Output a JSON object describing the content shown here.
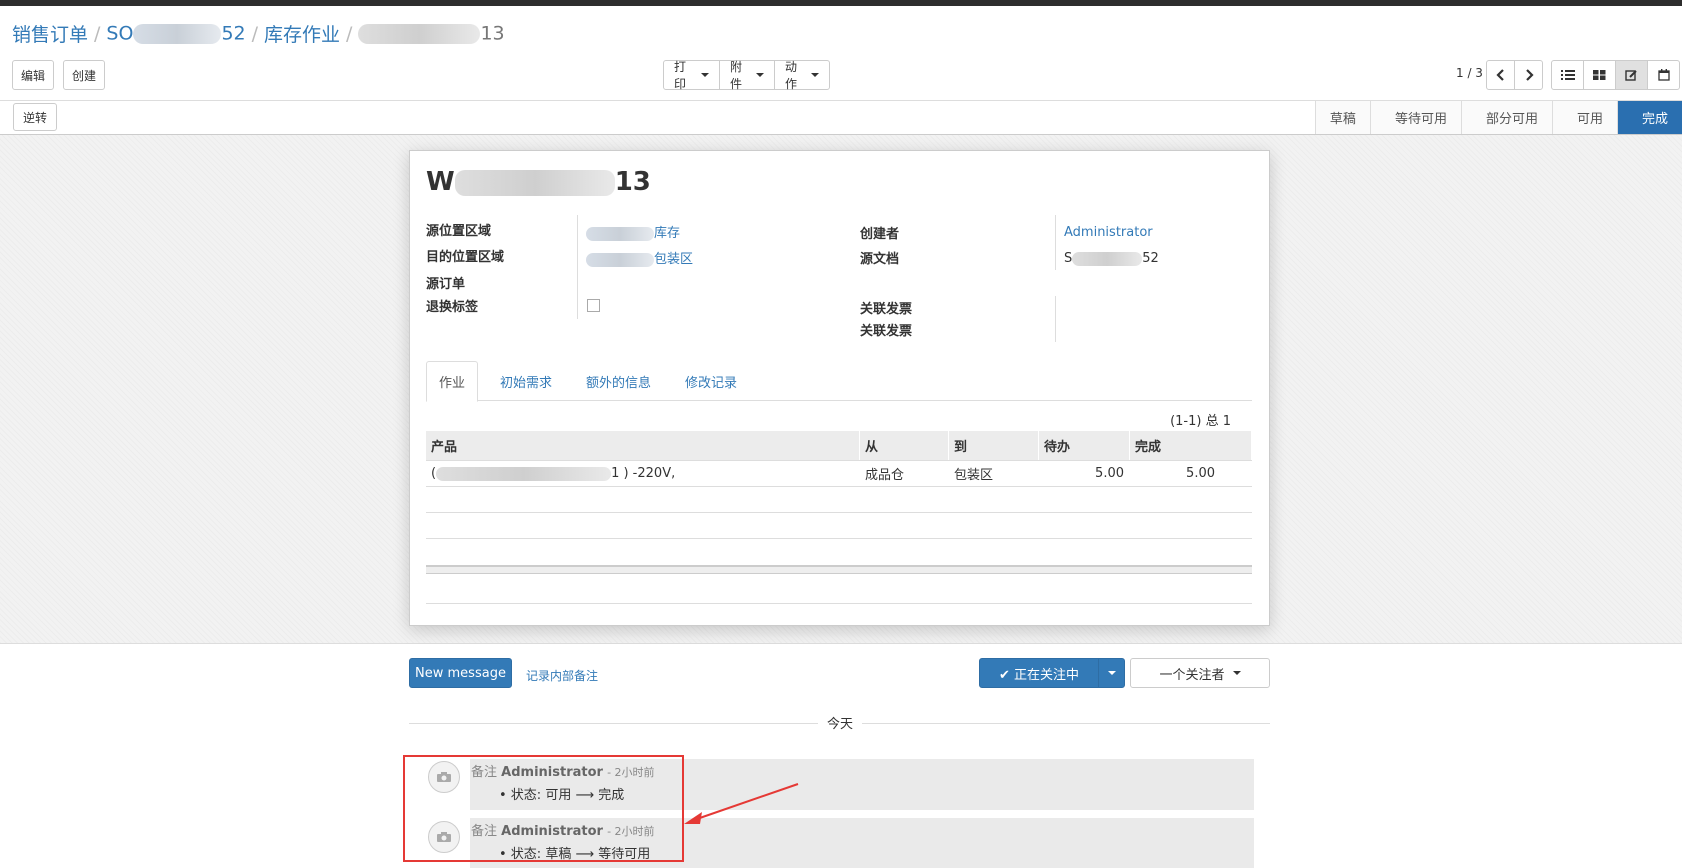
{
  "breadcrumb": {
    "items": [
      "销售订单",
      "SO",
      "52",
      "库存作业",
      "13"
    ],
    "sep": "/"
  },
  "toolbar": {
    "edit": "编辑",
    "create": "创建",
    "print": "打印",
    "attachments": "附件",
    "action": "动作",
    "pager": "1 / 3"
  },
  "statusbar": {
    "reverse": "逆转",
    "stages": [
      "草稿",
      "等待可用",
      "部分可用",
      "可用",
      "完成"
    ],
    "active": "完成"
  },
  "record": {
    "title_prefix": "W",
    "title_suffix": "13",
    "fields_left": [
      {
        "label": "源位置区域",
        "value": "库存"
      },
      {
        "label": "目的位置区域",
        "value": "包装区"
      },
      {
        "label": "源订单",
        "value": ""
      },
      {
        "label": "退换标签",
        "value": ""
      }
    ],
    "fields_right": [
      {
        "label": "创建者",
        "value": "Administrator"
      },
      {
        "label": "源文档",
        "value_prefix": "S",
        "value_suffix": "52"
      },
      {
        "label": "关联发票",
        "value": ""
      },
      {
        "label": "关联发票",
        "value": ""
      }
    ]
  },
  "tabs": [
    "作业",
    "初始需求",
    "额外的信息",
    "修改记录"
  ],
  "table": {
    "record_count": "(1-1) 总 1",
    "headers": [
      "产品",
      "从",
      "到",
      "待办",
      "完成"
    ],
    "rows": [
      {
        "product_prefix": "(",
        "product_suffix": "1 ) -220V,",
        "from": "成品仓",
        "to": "包装区",
        "todo": "5.00",
        "done": "5.00"
      }
    ]
  },
  "chatter": {
    "new_message": "New message",
    "log_note": "记录内部备注",
    "following": "✔ 正在关注中",
    "followers": "一个关注者",
    "today": "今天",
    "messages": [
      {
        "type": "备注",
        "author": "Administrator",
        "time": "- 2小时前",
        "body": "• 状态: 可用 ⟶ 完成"
      },
      {
        "type": "备注",
        "author": "Administrator",
        "time": "- 2小时前",
        "body": "• 状态: 草稿 ⟶ 等待可用"
      }
    ]
  },
  "colors": {
    "primary": "#337ab7",
    "active_stage": "#2a6fb0",
    "annotation": "#e53935"
  }
}
